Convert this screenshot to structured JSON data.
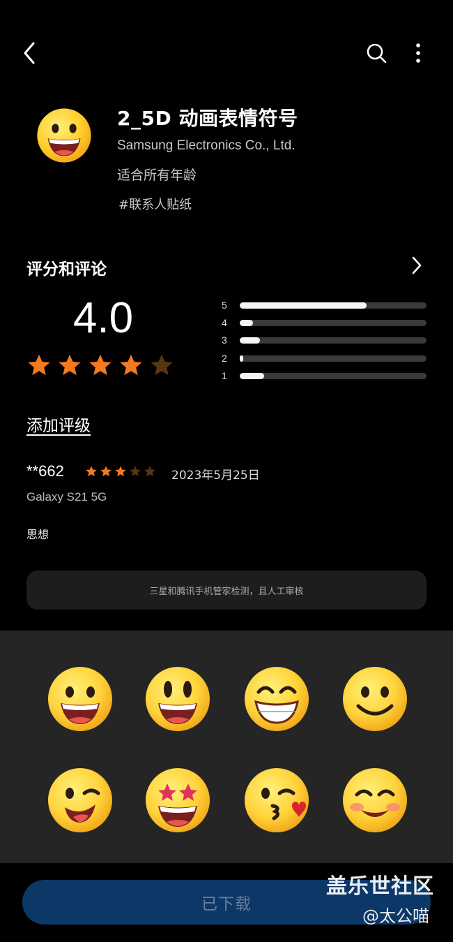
{
  "header": {
    "back_icon": "chevron-left-icon",
    "search_icon": "search-icon",
    "more_icon": "more-vertical-icon"
  },
  "app": {
    "icon": "grinning-face-emoji",
    "title": "2_5D 动画表情符号",
    "developer": "Samsung Electronics Co., Ltd.",
    "age_rating": "适合所有年龄",
    "tag": "#联系人贴纸"
  },
  "ratings": {
    "section_title": "评分和评论",
    "average": "4.0",
    "stars_filled": 4,
    "stars_total": 5,
    "distribution": [
      {
        "label": "5",
        "fraction": 0.68
      },
      {
        "label": "4",
        "fraction": 0.07
      },
      {
        "label": "3",
        "fraction": 0.11
      },
      {
        "label": "2",
        "fraction": 0.02
      },
      {
        "label": "1",
        "fraction": 0.13
      }
    ],
    "add_rating_label": "添加评级"
  },
  "review": {
    "user": "**662",
    "stars": 3,
    "date": "2023年5月25日",
    "device": "Galaxy S21 5G",
    "text": "思想"
  },
  "notice": "三星和腾讯手机管家检测，且人工审核",
  "preview_emojis": [
    "grinning-face",
    "grinning-face-big-eyes",
    "beaming-face",
    "smiling-face",
    "winking-face",
    "star-struck-face",
    "kissing-heart-face",
    "smiling-blush-face"
  ],
  "footer": {
    "button_label": "已下载"
  },
  "watermark": {
    "line1": "盖乐世社区",
    "line2": "@太公喵"
  },
  "colors": {
    "star": "#f47a1f",
    "star_dim": "#5a3512",
    "button": "#0c3867",
    "emoji": "#ffd33a"
  }
}
